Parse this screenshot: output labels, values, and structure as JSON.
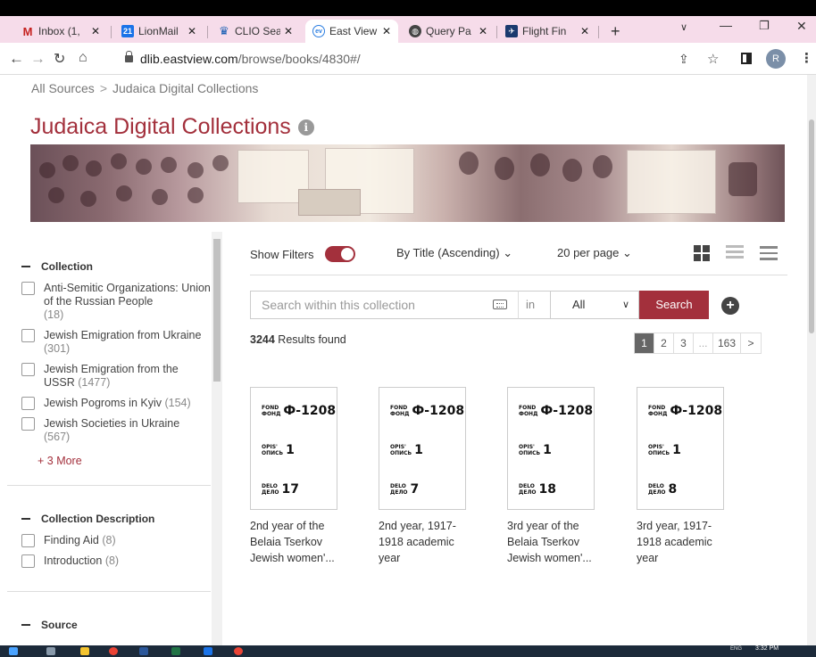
{
  "tabs": [
    {
      "label": "Inbox (1,",
      "icon": "gmail-icon",
      "color": "#c5221f",
      "active": false
    },
    {
      "label": "LionMail",
      "icon": "calendar-icon",
      "color": "#1a73e8",
      "active": false
    },
    {
      "label": "CLIO Sea",
      "icon": "crown-icon",
      "color": "#1a5fb4",
      "active": false
    },
    {
      "label": "East View",
      "icon": "eastview-icon",
      "color": "#2a7de1",
      "active": true
    },
    {
      "label": "Query Pa",
      "icon": "globe-icon",
      "color": "#444444",
      "active": false
    },
    {
      "label": "Flight Fin",
      "icon": "flight-icon",
      "color": "#1a3a6e",
      "active": false
    }
  ],
  "url": {
    "domain": "dlib.eastview.com",
    "path": "/browse/books/4830#/"
  },
  "profile_initial": "R",
  "breadcrumb": {
    "root": "All Sources",
    "current": "Judaica Digital Collections"
  },
  "page_title": "Judaica Digital Collections",
  "filters": {
    "collection": {
      "title": "Collection",
      "items": [
        {
          "label": "Anti-Semitic Organizations: Union of the Russian People",
          "count": "(18)"
        },
        {
          "label": "Jewish Emigration from Ukraine",
          "count": "(301)"
        },
        {
          "label": "Jewish Emigration from the USSR",
          "count": "(1477)"
        },
        {
          "label": "Jewish Pogroms in Kyiv",
          "count": "(154)"
        },
        {
          "label": "Jewish Societies in Ukraine",
          "count": "(567)"
        }
      ],
      "more": "+ 3 More"
    },
    "description": {
      "title": "Collection Description",
      "items": [
        {
          "label": "Finding Aid",
          "count": "(8)"
        },
        {
          "label": "Introduction",
          "count": "(8)"
        }
      ]
    },
    "source": {
      "title": "Source"
    }
  },
  "toolbar": {
    "show_filters": "Show Filters",
    "sort": "By Title (Ascending)",
    "per_page": "20 per page"
  },
  "search": {
    "placeholder": "Search within this collection",
    "in_label": "in",
    "scope": "All",
    "button": "Search"
  },
  "results": {
    "count": "3244",
    "label": "Results found"
  },
  "pagination": [
    "1",
    "2",
    "3",
    "...",
    "163",
    ">"
  ],
  "cards": [
    {
      "fond": "Ф-1208",
      "opis": "1",
      "delo": "17",
      "title_lines": [
        "2nd year of the",
        "Belaia Tserkov",
        "Jewish women'..."
      ]
    },
    {
      "fond": "Ф-1208",
      "opis": "1",
      "delo": "7",
      "title_lines": [
        "2nd year, 1917-",
        "1918 academic",
        "year"
      ]
    },
    {
      "fond": "Ф-1208",
      "opis": "1",
      "delo": "18",
      "title_lines": [
        "3rd year of the",
        "Belaia Tserkov",
        "Jewish women'..."
      ]
    },
    {
      "fond": "Ф-1208",
      "opis": "1",
      "delo": "8",
      "title_lines": [
        "3rd year, 1917-",
        "1918 academic",
        "year"
      ]
    }
  ],
  "card_labels": {
    "fond_en": "FOND",
    "fond_ru": "ФОНД",
    "opis_en": "OPIS'",
    "opis_ru": "ОПИСЬ",
    "delo_en": "DELO",
    "delo_ru": "ДЕЛО"
  },
  "colors": {
    "accent": "#a3303c",
    "tabstrip": "#f6dcea"
  },
  "clock": "3:32 PM",
  "lang": "ENG"
}
